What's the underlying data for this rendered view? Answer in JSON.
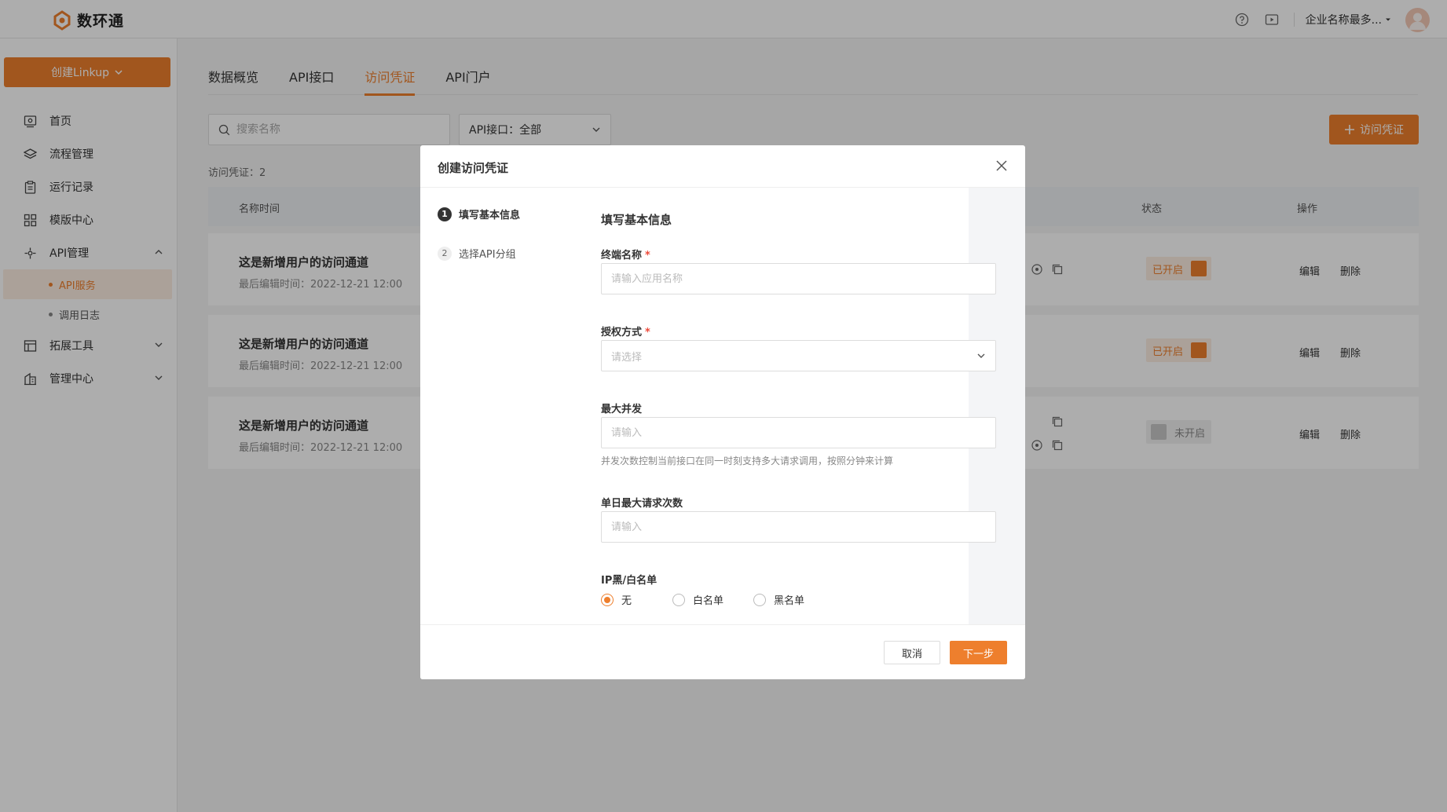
{
  "app": {
    "logo_text": "数环通",
    "company_name": "企业名称最多...",
    "brand_color": "#ee7f2d"
  },
  "sidebar": {
    "create_label": "创建Linkup",
    "items": [
      {
        "label": "首页",
        "icon": "home-icon"
      },
      {
        "label": "流程管理",
        "icon": "layers-icon"
      },
      {
        "label": "运行记录",
        "icon": "clipboard-icon"
      },
      {
        "label": "模版中心",
        "icon": "grid-icon"
      },
      {
        "label": "API管理",
        "icon": "api-icon",
        "expanded": true
      },
      {
        "label": "拓展工具",
        "icon": "panel-icon"
      },
      {
        "label": "管理中心",
        "icon": "building-icon"
      }
    ],
    "sub_items": [
      {
        "label": "API服务",
        "active": true
      },
      {
        "label": "调用日志",
        "active": false
      }
    ]
  },
  "main": {
    "tabs": [
      {
        "label": "数据概览",
        "active": false
      },
      {
        "label": "API接口",
        "active": false
      },
      {
        "label": "访问凭证",
        "active": true
      },
      {
        "label": "API门户",
        "active": false
      }
    ],
    "search_placeholder": "搜索名称",
    "filter_label": "API接口：全部",
    "add_label": "访问凭证",
    "count_label": "访问凭证：2",
    "table": {
      "headers": {
        "name": "名称时间",
        "status": "状态",
        "ops": "操作"
      },
      "rows": [
        {
          "title": "这是新增用户的访问通道",
          "sub": "最后编辑时间：2022-12-21 12:00",
          "status": "已开启",
          "on": true,
          "edit": "编辑",
          "delete": "删除"
        },
        {
          "title": "这是新增用户的访问通道",
          "sub": "最后编辑时间：2022-12-21 12:00",
          "status": "已开启",
          "on": true,
          "edit": "编辑",
          "delete": "删除"
        },
        {
          "title": "这是新增用户的访问通道",
          "sub": "最后编辑时间：2022-12-21 12:00",
          "status": "未开启",
          "on": false,
          "edit": "编辑",
          "delete": "删除"
        }
      ]
    }
  },
  "modal": {
    "title": "创建访问凭证",
    "steps": [
      {
        "num": "1",
        "label": "填写基本信息",
        "active": true
      },
      {
        "num": "2",
        "label": "选择API分组",
        "active": false
      }
    ],
    "form_title": "填写基本信息",
    "fields": {
      "terminal_name": {
        "label": "终端名称",
        "required": "*",
        "placeholder": "请输入应用名称",
        "value": ""
      },
      "auth_method": {
        "label": "授权方式",
        "required": "*",
        "placeholder": "请选择"
      },
      "max_concurrency": {
        "label": "最大并发",
        "placeholder": "请输入",
        "value": "",
        "help": "并发次数控制当前接口在同一时刻支持多大请求调用，按照分钟来计算"
      },
      "daily_max": {
        "label": "单日最大请求次数",
        "placeholder": "请输入",
        "value": ""
      },
      "ip_list": {
        "label": "IP黑/白名单",
        "options": [
          "无",
          "白名单",
          "黑名单"
        ],
        "selected": "无"
      }
    },
    "cancel_label": "取消",
    "next_label": "下一步"
  }
}
